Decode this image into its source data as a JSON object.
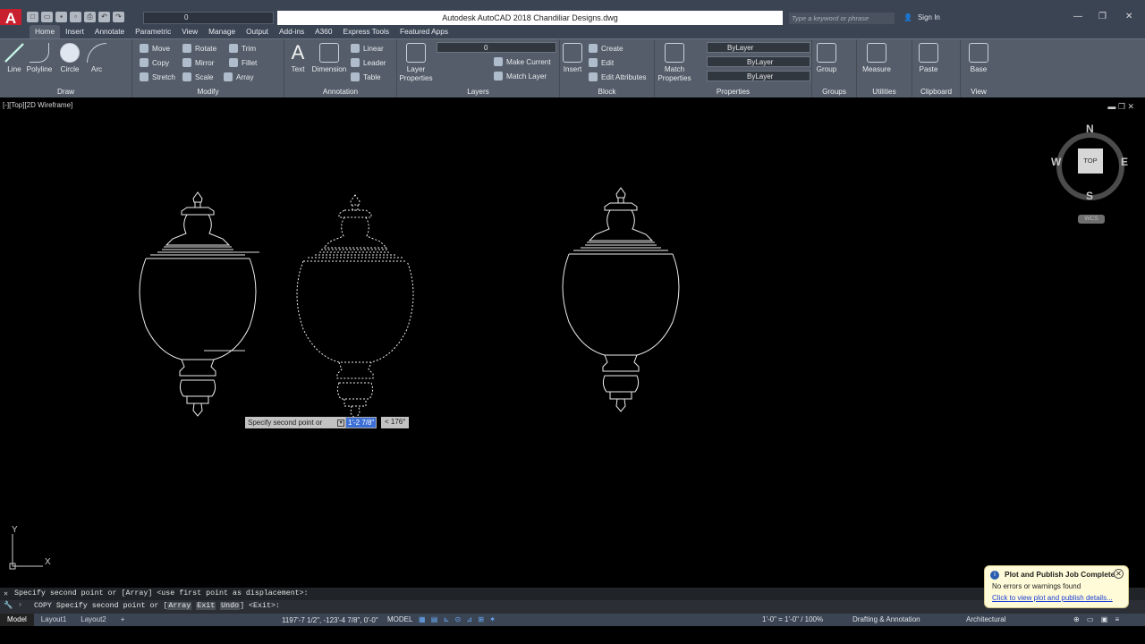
{
  "app": {
    "title": "Autodesk AutoCAD 2018    Chandiliar Designs.dwg",
    "logo": "A",
    "layer_combo": "0",
    "search_placeholder": "Type a keyword or phrase",
    "sign_in": "Sign In"
  },
  "tabs": [
    "Home",
    "Insert",
    "Annotate",
    "Parametric",
    "View",
    "Manage",
    "Output",
    "Add-ins",
    "A360",
    "Express Tools",
    "Featured Apps"
  ],
  "ribbon": {
    "draw": {
      "title": "Draw",
      "line": "Line",
      "polyline": "Polyline",
      "circle": "Circle",
      "arc": "Arc"
    },
    "modify": {
      "title": "Modify",
      "move": "Move",
      "rotate": "Rotate",
      "trim": "Trim",
      "copy": "Copy",
      "mirror": "Mirror",
      "fillet": "Fillet",
      "stretch": "Stretch",
      "scale": "Scale",
      "array": "Array"
    },
    "annotation": {
      "title": "Annotation",
      "text": "Text",
      "dimension": "Dimension",
      "linear": "Linear",
      "leader": "Leader",
      "table": "Table"
    },
    "layers": {
      "title": "Layers",
      "layer_properties": "Layer Properties",
      "current_layer": "0",
      "make_current": "Make Current",
      "match_layer": "Match Layer"
    },
    "block": {
      "title": "Block",
      "insert": "Insert",
      "create": "Create",
      "edit": "Edit",
      "edit_attributes": "Edit Attributes"
    },
    "properties": {
      "title": "Properties",
      "match_properties": "Match Properties",
      "color": "ByLayer",
      "linetype": "ByLayer",
      "lineweight": "ByLayer"
    },
    "groups": {
      "title": "Groups",
      "group": "Group"
    },
    "utilities": {
      "title": "Utilities",
      "measure": "Measure"
    },
    "clipboard": {
      "title": "Clipboard",
      "paste": "Paste"
    },
    "view": {
      "title": "View",
      "base": "Base"
    }
  },
  "viewport": {
    "label": "[-][Top][2D Wireframe]",
    "cube_face": "TOP",
    "north": "N",
    "south": "S",
    "east": "E",
    "west": "W",
    "wcs": "WCS",
    "ucs_y": "Y",
    "ucs_x": "X"
  },
  "dynamic_input": {
    "prompt": "Specify second point or",
    "distance": "1'-2 7/8\"",
    "angle": "< 176°"
  },
  "command": {
    "history": "Specify second point or [Array] <use first point as displacement>:",
    "prefix": "COPY Specify second point or [",
    "opt1": "Array",
    "opt2": "Exit",
    "opt3": "Undo",
    "suffix": "] <Exit>:"
  },
  "layout_tabs": [
    "Model",
    "Layout1",
    "Layout2"
  ],
  "status": {
    "coords": "1197'-7 1/2\", -123'-4 7/8\", 0'-0\"",
    "model": "MODEL",
    "scale": "1'-0\" = 1'-0\" / 100%",
    "workspace": "Drafting & Annotation",
    "units": "Architectural"
  },
  "notification": {
    "title": "Plot and Publish Job Complete",
    "message": "No errors or warnings found",
    "link": "Click to view plot and publish details..."
  }
}
